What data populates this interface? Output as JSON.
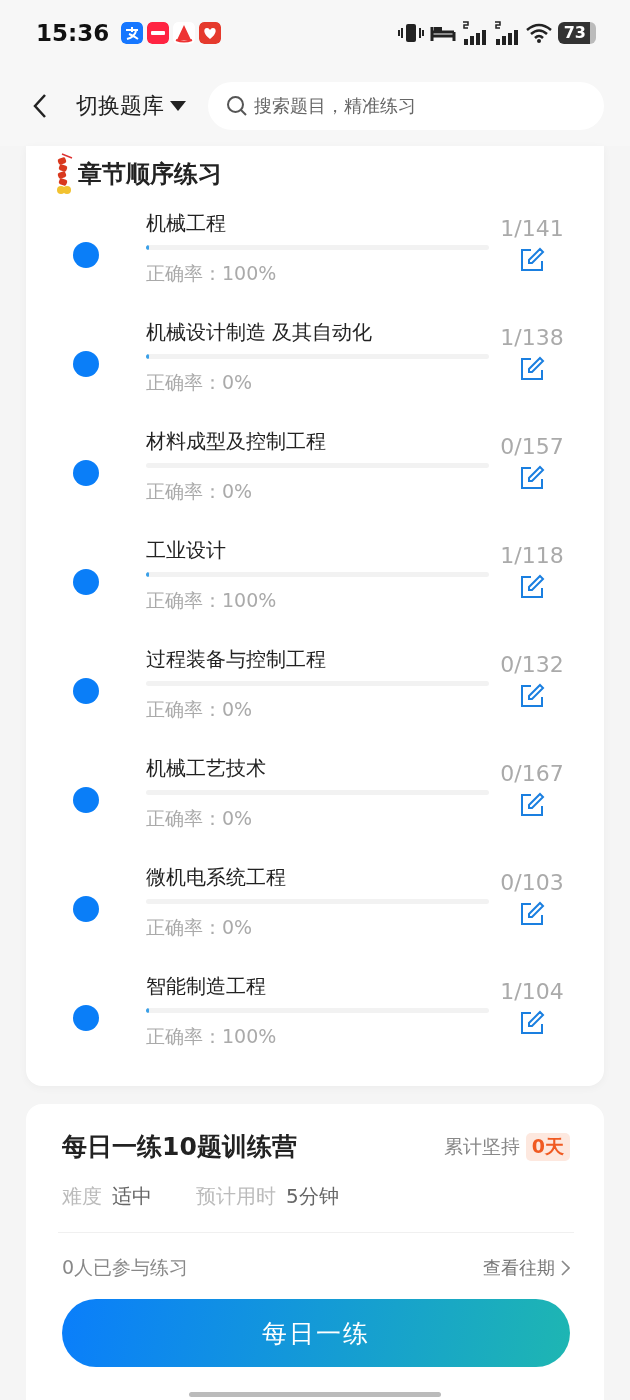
{
  "status_bar": {
    "time": "15:36",
    "battery": "73"
  },
  "header": {
    "title": "切换题库",
    "search_placeholder": "搜索题目，精准练习"
  },
  "chapter_section": {
    "title": "章节顺序练习",
    "chapters": [
      {
        "name": "机械工程",
        "level": 0.007,
        "accuracy": "正确率：100%",
        "count": "1/141"
      },
      {
        "name": "机械设计制造 及其自动化",
        "level": 0.007,
        "accuracy": "正确率：0%",
        "count": "1/138"
      },
      {
        "name": "材料成型及控制工程",
        "accuracy": "正确率：0%",
        "count": "0/157"
      },
      {
        "name": "工业设计",
        "level": 0.008,
        "accuracy": "正确率：100%",
        "count": "1/118"
      },
      {
        "name": "过程装备与控制工程",
        "accuracy": "正确率：0%",
        "count": "0/132"
      },
      {
        "name": "机械工艺技术",
        "accuracy": "正确率：0%",
        "count": "0/167"
      },
      {
        "name": "微机电系统工程",
        "accuracy": "正确率：0%",
        "count": "0/103"
      },
      {
        "name": "智能制造工程",
        "level": 0.01,
        "accuracy": "正确率：100%",
        "count": "1/104"
      }
    ]
  },
  "daily_camp": {
    "title": "每日一练10题训练营",
    "streak_label": "累计坚持",
    "streak_value": "0天",
    "difficulty_label": "难度",
    "difficulty_value": "适中",
    "time_label": "预计用时",
    "time_value": "5分钟",
    "participants": "0人已参与练习",
    "history_link": "查看往期",
    "start_button": "每日一练"
  }
}
